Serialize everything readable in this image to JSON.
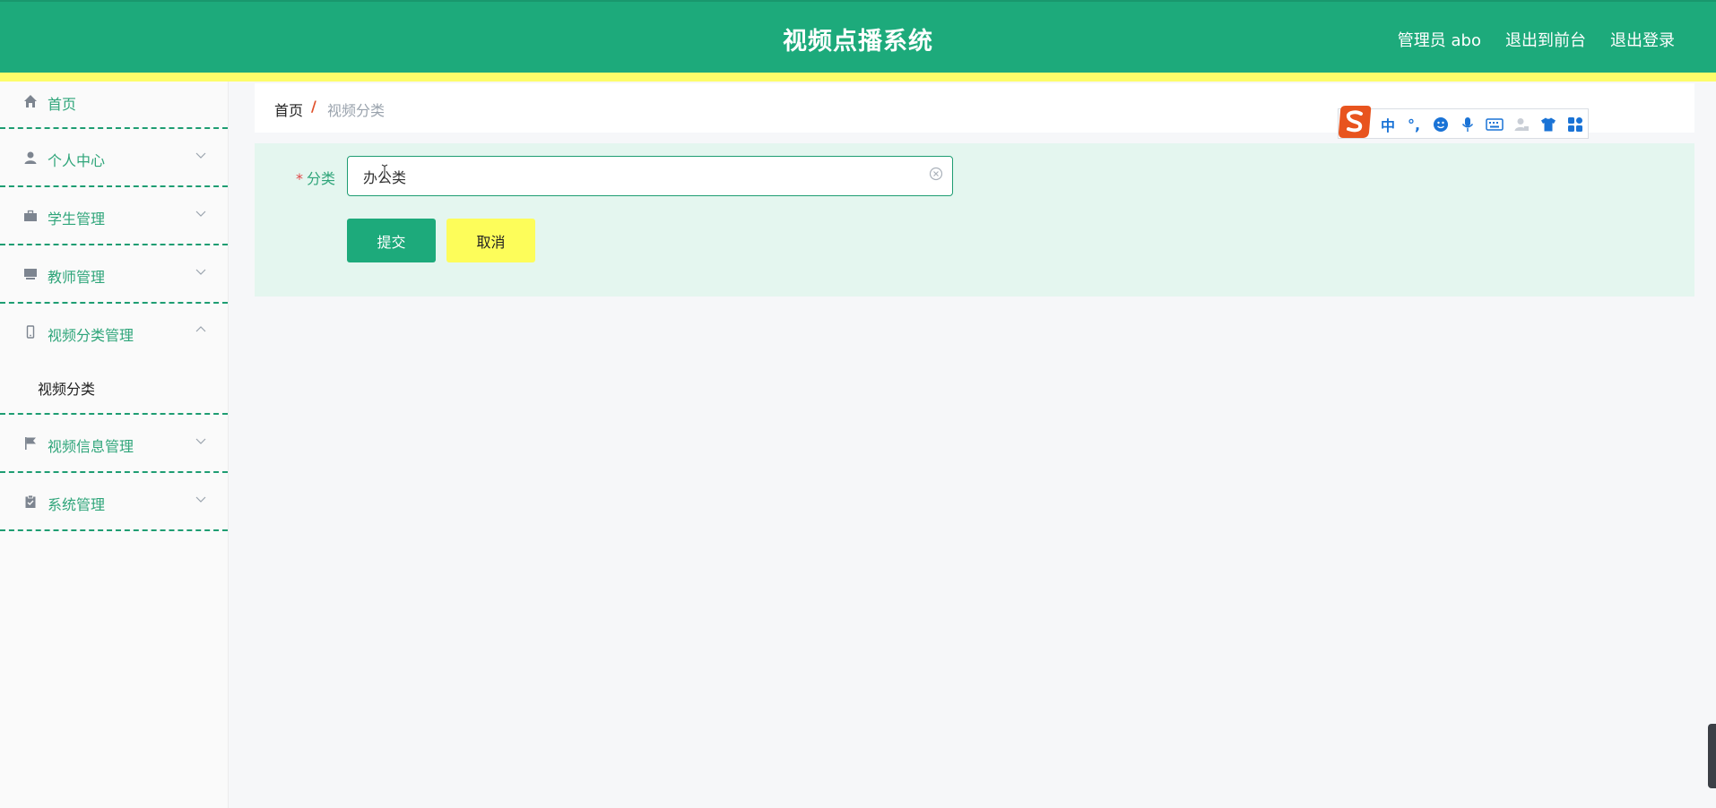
{
  "header": {
    "title": "视频点播系统",
    "user_label": "管理员 abo",
    "links": [
      "退出到前台",
      "退出登录"
    ]
  },
  "sidebar": {
    "items": [
      {
        "label": "首页",
        "icon": "home-icon"
      },
      {
        "label": "个人中心",
        "icon": "user-icon"
      },
      {
        "label": "学生管理",
        "icon": "briefcase-icon"
      },
      {
        "label": "教师管理",
        "icon": "monitor-icon"
      },
      {
        "label": "视频分类管理",
        "icon": "phone-icon",
        "open": true,
        "children": [
          "视频分类"
        ]
      },
      {
        "label": "视频信息管理",
        "icon": "flag-icon"
      },
      {
        "label": "系统管理",
        "icon": "clipboard-icon"
      }
    ]
  },
  "breadcrumb": {
    "home": "首页",
    "separator": "/",
    "current": "视频分类"
  },
  "form": {
    "field_label": "分类",
    "required_mark": "*",
    "field_value": "办公类",
    "submit_label": "提交",
    "cancel_label": "取消"
  },
  "ime_toolbar": {
    "mode_label": "中",
    "punct_label": "°,"
  },
  "colors": {
    "primary": "#1daa7b",
    "accent_yellow": "#fdfd5a",
    "form_bg": "#e4f6ef"
  }
}
